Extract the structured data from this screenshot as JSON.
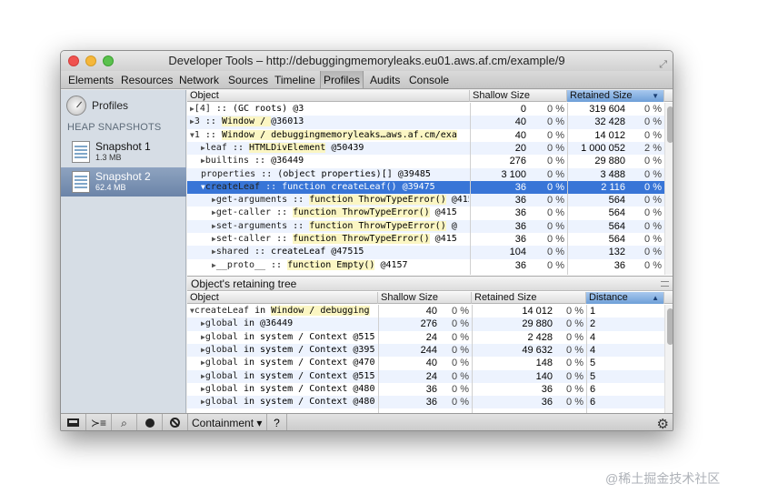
{
  "window": {
    "title": "Developer Tools – http://debuggingmemoryleaks.eu01.aws.af.cm/example/9"
  },
  "toolbar": {
    "tabs": [
      "Elements",
      "Resources",
      "Network",
      "Sources",
      "Timeline",
      "Profiles",
      "Audits",
      "Console"
    ],
    "active": "Profiles"
  },
  "sidebar": {
    "profiles_label": "Profiles",
    "section_title": "HEAP SNAPSHOTS",
    "snapshots": [
      {
        "name": "Snapshot 1",
        "size": "1.3 MB",
        "selected": false
      },
      {
        "name": "Snapshot 2",
        "size": "62.4 MB",
        "selected": true
      }
    ]
  },
  "top_table": {
    "headers": {
      "object": "Object",
      "shallow": "Shallow Size",
      "retained": "Retained Size"
    },
    "rows": [
      {
        "tri": "▶",
        "name": "[4]",
        "rest": " :: (GC roots) @3",
        "hl": "",
        "tail": "",
        "shallow": "0",
        "sp": "0 %",
        "retained": "319 604",
        "rp": "0 %"
      },
      {
        "tri": "▶",
        "name": "3",
        "rest": " :: ",
        "hl": "Window / ",
        "tail": "@36013",
        "shallow": "40",
        "sp": "0 %",
        "retained": "32 428",
        "rp": "0 %"
      },
      {
        "tri": "▼",
        "name": "1",
        "rest": " :: ",
        "hl": "Window / debuggingmemoryleaks…aws.af.cm/exa",
        "tail": "",
        "shallow": "40",
        "sp": "0 %",
        "retained": "14 012",
        "rp": "0 %"
      },
      {
        "tri": "▶",
        "name": "leaf",
        "rest": " :: ",
        "hl": "HTMLDivElement",
        "tail": " @50439",
        "shallow": "20",
        "sp": "0 %",
        "retained": "1 000 052",
        "rp": "2 %"
      },
      {
        "tri": "▶",
        "name": "builtins",
        "rest": " :: @36449",
        "hl": "",
        "tail": "",
        "shallow": "276",
        "sp": "0 %",
        "retained": "29 880",
        "rp": "0 %"
      },
      {
        "tri": "",
        "name": "properties",
        "rest": " :: (object properties)[] @39485",
        "hl": "",
        "tail": "",
        "shallow": "3 100",
        "sp": "0 %",
        "retained": "3 488",
        "rp": "0 %"
      },
      {
        "tri": "▼",
        "name": "createLeaf",
        "rest": " :: function createLeaf() @39475",
        "hl": "",
        "tail": "",
        "shallow": "36",
        "sp": "0 %",
        "retained": "2 116",
        "rp": "0 %"
      },
      {
        "tri": "▶",
        "name": "get-arguments",
        "rest": " :: ",
        "hl": "function ThrowTypeError()",
        "tail": " @415",
        "shallow": "36",
        "sp": "0 %",
        "retained": "564",
        "rp": "0 %"
      },
      {
        "tri": "▶",
        "name": "get-caller",
        "rest": " :: ",
        "hl": "function ThrowTypeError()",
        "tail": " @415",
        "shallow": "36",
        "sp": "0 %",
        "retained": "564",
        "rp": "0 %"
      },
      {
        "tri": "▶",
        "name": "set-arguments",
        "rest": " :: ",
        "hl": "function ThrowTypeError()",
        "tail": " @",
        "shallow": "36",
        "sp": "0 %",
        "retained": "564",
        "rp": "0 %"
      },
      {
        "tri": "▶",
        "name": "set-caller",
        "rest": " :: ",
        "hl": "function ThrowTypeError()",
        "tail": " @415",
        "shallow": "36",
        "sp": "0 %",
        "retained": "564",
        "rp": "0 %"
      },
      {
        "tri": "▶",
        "name": "shared",
        "rest": " :: createLeaf @47515",
        "hl": "",
        "tail": "",
        "shallow": "104",
        "sp": "0 %",
        "retained": "132",
        "rp": "0 %"
      },
      {
        "tri": "▶",
        "name": "__proto__",
        "rest": " :: ",
        "hl": "function Empty()",
        "tail": " @4157",
        "shallow": "36",
        "sp": "0 %",
        "retained": "36",
        "rp": "0 %"
      }
    ]
  },
  "retaining": {
    "title": "Object's retaining tree",
    "headers": {
      "object": "Object",
      "shallow": "Shallow Size",
      "retained": "Retained Size",
      "distance": "Distance"
    },
    "rows": [
      {
        "tri": "▼",
        "name": "createLeaf",
        "rest": " in ",
        "hl": "Window / debugging",
        "shallow": "40",
        "sp": "0 %",
        "retained": "14 012",
        "rp": "0 %",
        "distance": "1"
      },
      {
        "tri": "▶",
        "name": "global",
        "rest": " in @36449",
        "hl": "",
        "shallow": "276",
        "sp": "0 %",
        "retained": "29 880",
        "rp": "0 %",
        "distance": "2"
      },
      {
        "tri": "▶",
        "name": "global",
        "rest": " in system / Context @515",
        "hl": "",
        "shallow": "24",
        "sp": "0 %",
        "retained": "2 428",
        "rp": "0 %",
        "distance": "4"
      },
      {
        "tri": "▶",
        "name": "global",
        "rest": " in system / Context @395",
        "hl": "",
        "shallow": "244",
        "sp": "0 %",
        "retained": "49 632",
        "rp": "0 %",
        "distance": "4"
      },
      {
        "tri": "▶",
        "name": "global",
        "rest": " in system / Context @470",
        "hl": "",
        "shallow": "40",
        "sp": "0 %",
        "retained": "148",
        "rp": "0 %",
        "distance": "5"
      },
      {
        "tri": "▶",
        "name": "global",
        "rest": " in system / Context @515",
        "hl": "",
        "shallow": "24",
        "sp": "0 %",
        "retained": "140",
        "rp": "0 %",
        "distance": "5"
      },
      {
        "tri": "▶",
        "name": "global",
        "rest": " in system / Context @480",
        "hl": "",
        "shallow": "36",
        "sp": "0 %",
        "retained": "36",
        "rp": "0 %",
        "distance": "6"
      },
      {
        "tri": "▶",
        "name": "global",
        "rest": " in system / Context @480",
        "hl": "",
        "shallow": "36",
        "sp": "0 %",
        "retained": "36",
        "rp": "0 %",
        "distance": "6"
      }
    ]
  },
  "statusbar": {
    "containment": "Containment",
    "dropdown_glyph": "▾",
    "help": "?"
  },
  "watermark": "@稀土掘金技术社区"
}
